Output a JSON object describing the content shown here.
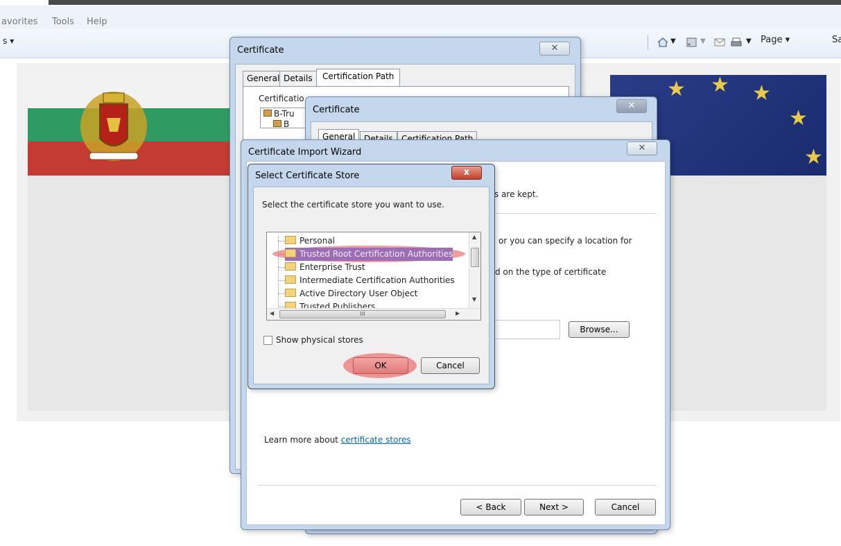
{
  "browser": {
    "menu": [
      "avorites",
      "Tools",
      "Help"
    ],
    "cmd_left": "s ▾",
    "cmd_page": "Page ▾",
    "cmd_safety": "Sa"
  },
  "cert_dialog_1": {
    "title": "Certificate",
    "tabs": [
      "General",
      "Details",
      "Certification Path"
    ],
    "group_label": "Certificatio",
    "path_items": [
      "B-Tru",
      "B"
    ]
  },
  "cert_dialog_2": {
    "title": "Certificate",
    "tabs": [
      "General",
      "Details",
      "Certification Path"
    ]
  },
  "import_wizard": {
    "title": "Certificate Import Wizard",
    "text1": "s are kept.",
    "text2": "or you can specify a location for",
    "text3": "d on the type of certificate",
    "browse_label": "Browse...",
    "learn_more_prefix": "Learn more about ",
    "learn_more_link": "certificate stores",
    "back_label": "< Back",
    "next_label": "Next >",
    "cancel_label": "Cancel"
  },
  "store_dialog": {
    "title": "Select Certificate Store",
    "prompt": "Select the certificate store you want to use.",
    "stores": [
      "Personal",
      "Trusted Root Certification Authorities",
      "Enterprise Trust",
      "Intermediate Certification Authorities",
      "Active Directory User Object",
      "Trusted Publishers"
    ],
    "selected_store": "Trusted Root Certification Authorities",
    "show_physical_label": "Show physical stores",
    "ok_label": "OK",
    "cancel_label": "Cancel",
    "close_glyph": "x",
    "hscroll_glyph": "III"
  },
  "colors": {
    "highlight": "#e84a4a",
    "link": "#0066cc"
  }
}
